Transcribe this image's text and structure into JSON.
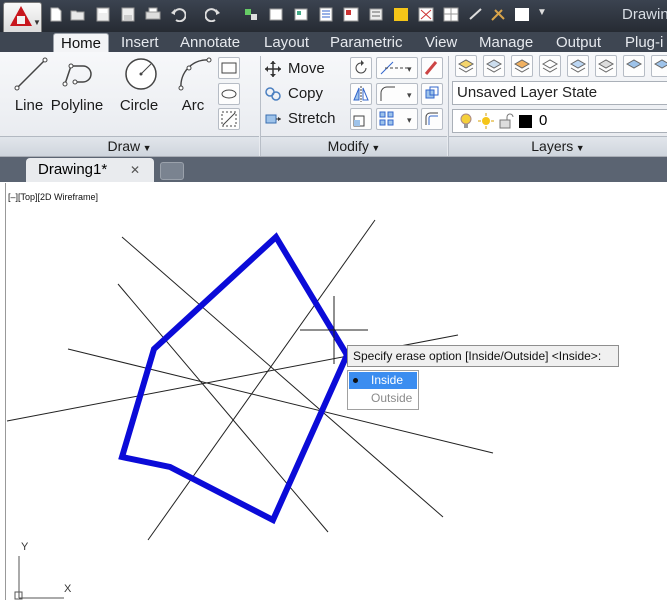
{
  "app": {
    "title": "Drawin"
  },
  "ribbon_tabs": [
    "Home",
    "Insert",
    "Annotate",
    "Layout",
    "Parametric",
    "View",
    "Manage",
    "Output",
    "Plug-i"
  ],
  "draw_panel": {
    "tools": [
      "Line",
      "Polyline",
      "Circle",
      "Arc"
    ],
    "label": "Draw",
    "dropdown_icon": "triangle-down"
  },
  "modify_panel": {
    "tools": [
      "Move",
      "Copy",
      "Stretch"
    ],
    "label": "Modify"
  },
  "layers_panel": {
    "layer_state": "Unsaved Layer State",
    "current_layer": "0",
    "label": "Layers"
  },
  "document": {
    "tab_name": "Drawing1*",
    "close_glyph": "✕"
  },
  "viewport": {
    "label": "[–][Top][2D Wireframe]"
  },
  "prompt": {
    "text": "Specify erase option [Inside/Outside] <Inside>:",
    "options": [
      "Inside",
      "Outside"
    ],
    "selected": "Inside"
  },
  "ucs": {
    "x_label": "X",
    "y_label": "Y"
  },
  "colors": {
    "polygon": "#0b0bd8",
    "ribbon_bg": "#e9ecf0",
    "titlebar": "#2c323b",
    "highlight": "#3b8df0"
  }
}
